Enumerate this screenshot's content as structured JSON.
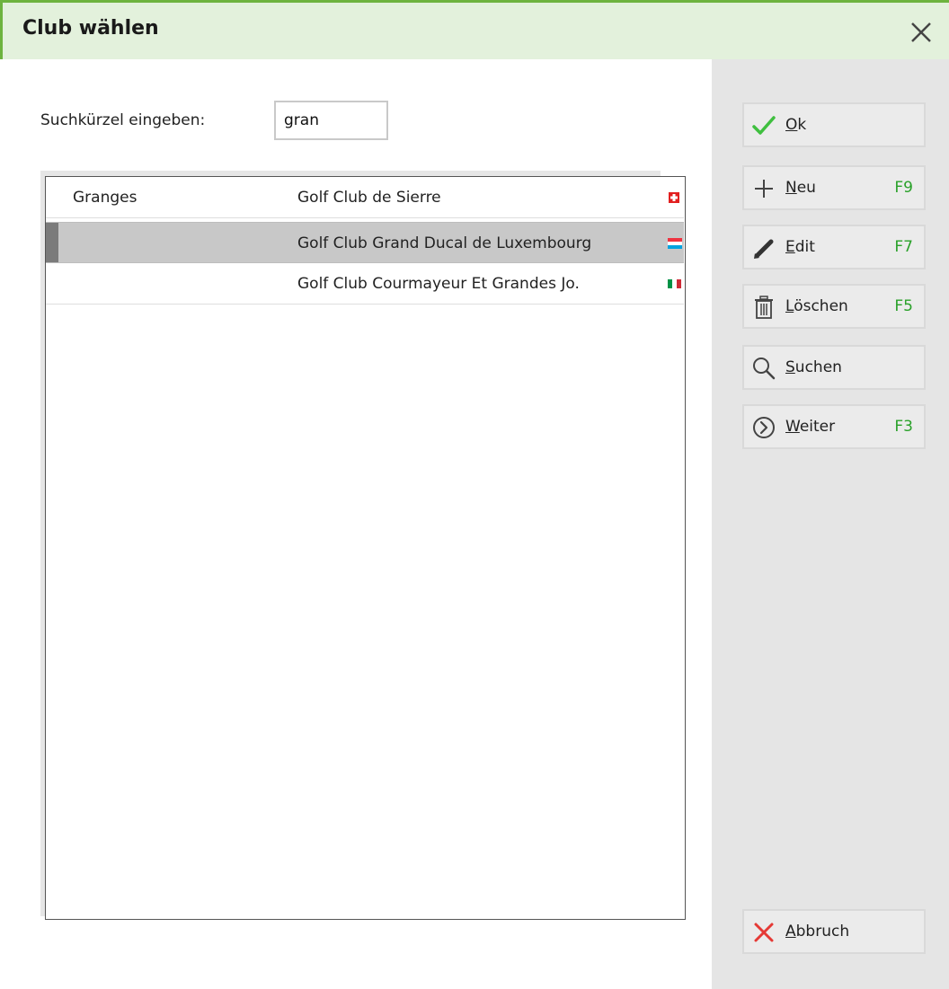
{
  "window": {
    "title": "Club wählen"
  },
  "search": {
    "label": "Suchkürzel eingeben:",
    "value": "gran"
  },
  "list": {
    "rows": [
      {
        "short": "Granges",
        "name": "Golf Club de Sierre",
        "flag": "switzerland-flag",
        "selected": false
      },
      {
        "short": "",
        "name": "Golf Club Grand Ducal de Luxembourg",
        "flag": "luxembourg-flag",
        "selected": true
      },
      {
        "short": "",
        "name": "Golf Club Courmayeur Et Grandes Jo.",
        "flag": "italy-flag",
        "selected": false
      }
    ]
  },
  "buttons": {
    "ok": {
      "mnemonic": "O",
      "rest": "k",
      "icon": "check-icon",
      "key": ""
    },
    "new": {
      "mnemonic": "N",
      "rest": "eu",
      "icon": "plus-icon",
      "key": "F9"
    },
    "edit": {
      "mnemonic": "E",
      "rest": "dit",
      "icon": "pencil-icon",
      "key": "F7"
    },
    "delete": {
      "mnemonic": "L",
      "rest": "öschen",
      "icon": "trash-icon",
      "key": "F5"
    },
    "search": {
      "mnemonic": "S",
      "rest": "uchen",
      "icon": "magnifier-icon",
      "key": ""
    },
    "next": {
      "mnemonic": "W",
      "rest": "eiter",
      "icon": "circle-chevron-right-icon",
      "key": "F3"
    },
    "cancel": {
      "mnemonic": "A",
      "rest": "bbruch",
      "icon": "x-icon",
      "key": ""
    }
  },
  "colors": {
    "accent": "#6db33f",
    "titlebar": "#e3f1dc",
    "ok_check": "#3fbf3f",
    "cancel_x": "#e53935",
    "shortcut": "#2aa12a"
  }
}
